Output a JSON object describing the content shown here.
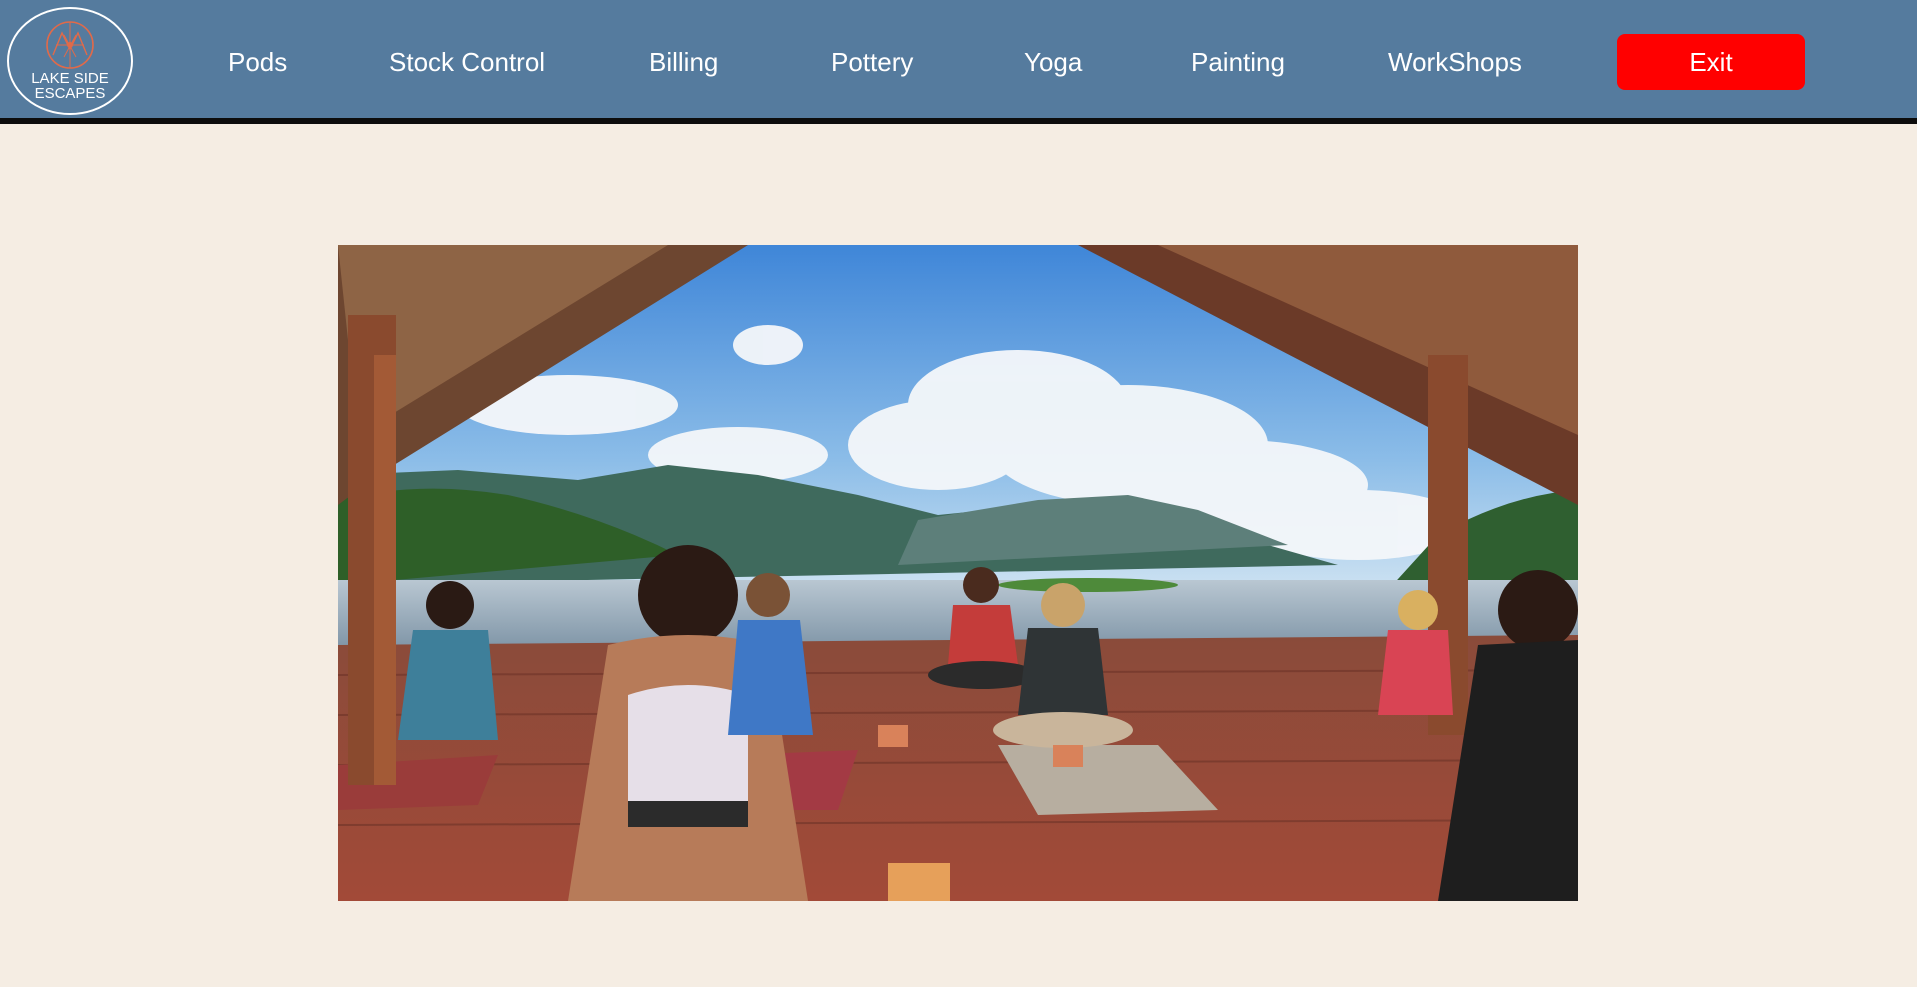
{
  "brand": {
    "logo_line1": "LAKE SIDE",
    "logo_line2": "ESCAPES",
    "logo_icon": "dreamcatcher-icon"
  },
  "nav": {
    "items": [
      {
        "label": "Pods"
      },
      {
        "label": "Stock Control"
      },
      {
        "label": "Billing"
      },
      {
        "label": "Pottery"
      },
      {
        "label": "Yoga"
      },
      {
        "label": "Painting"
      },
      {
        "label": "WorkShops"
      }
    ],
    "exit_label": "Exit"
  },
  "colors": {
    "navbar": "#557b9e",
    "background": "#f5ede3",
    "exit": "#ff0000",
    "logo_accent": "#e06a4a"
  },
  "hero": {
    "content": "photo-yoga-class-lakeside-pavilion"
  }
}
